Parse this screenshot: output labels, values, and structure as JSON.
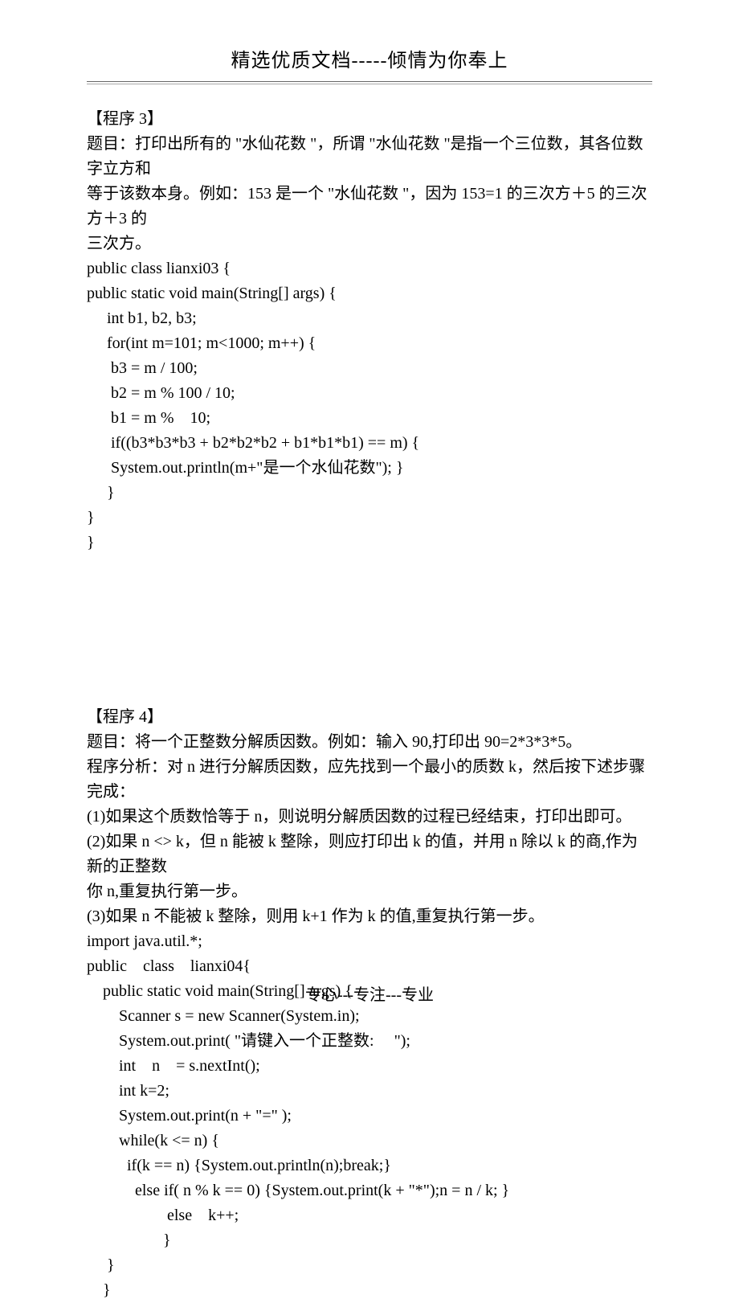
{
  "header": "精选优质文档-----倾情为你奉上",
  "program3": {
    "title": "【程序 3】",
    "desc_line1": "题目：打印出所有的 \"水仙花数 \"，所谓 \"水仙花数 \"是指一个三位数，其各位数字立方和",
    "desc_line2": "等于该数本身。例如：153 是一个 \"水仙花数 \"，因为 153=1 的三次方＋5 的三次方＋3 的",
    "desc_line3": "三次方。",
    "code": [
      "public class lianxi03 {",
      "public static void main(String[] args) {",
      "     int b1, b2, b3;",
      "     for(int m=101; m<1000; m++) {",
      "      b3 = m / 100;",
      "      b2 = m % 100 / 10;",
      "      b1 = m %    10;",
      "      if((b3*b3*b3 + b2*b2*b2 + b1*b1*b1) == m) {",
      "      System.out.println(m+\"是一个水仙花数\"); }",
      "     }",
      "}",
      "}"
    ]
  },
  "program4": {
    "title": "【程序 4】",
    "desc_line1": "题目：将一个正整数分解质因数。例如：输入 90,打印出 90=2*3*3*5。",
    "desc_line2": "程序分析：对 n 进行分解质因数，应先找到一个最小的质数 k，然后按下述步骤完成：",
    "desc_line3": "(1)如果这个质数恰等于 n，则说明分解质因数的过程已经结束，打印出即可。",
    "desc_line4": "(2)如果 n <> k，但 n 能被 k 整除，则应打印出 k 的值，并用 n 除以 k 的商,作为新的正整数",
    "desc_line5": "你 n,重复执行第一步。",
    "desc_line6": "(3)如果 n 不能被 k 整除，则用 k+1 作为 k 的值,重复执行第一步。",
    "code": [
      "import java.util.*;",
      "public    class    lianxi04{",
      "    public static void main(String[] args) {",
      "        Scanner s = new Scanner(System.in);",
      "        System.out.print( \"请键入一个正整数:     \");",
      "        int    n    = s.nextInt();",
      "        int k=2;",
      "        System.out.print(n + \"=\" );",
      "        while(k <= n) {",
      "          if(k == n) {System.out.println(n);break;}",
      "            else if( n % k == 0) {System.out.print(k + \"*\");n = n / k; }",
      "                    else    k++;",
      "                   }",
      "     }",
      "    }"
    ]
  },
  "footer": "专心---专注---专业"
}
